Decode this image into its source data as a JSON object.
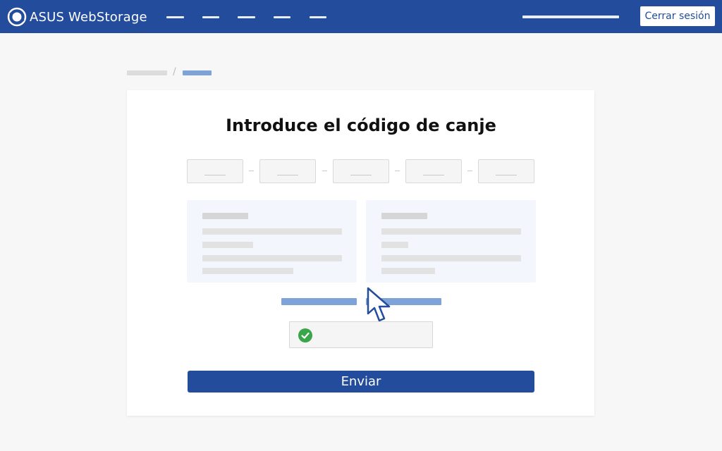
{
  "header": {
    "app_name": "ASUS WebStorage",
    "logout_label": "Cerrar sesión"
  },
  "main": {
    "title": "Introduce el código de canje",
    "submit_label": "Enviar"
  },
  "colors": {
    "brand": "#234d9c",
    "link": "#7ea3d9",
    "panel": "#f3f7fd",
    "success": "#3aa64a"
  },
  "icons": [
    "asus-logo-icon",
    "cursor-icon",
    "check-circle-icon"
  ]
}
